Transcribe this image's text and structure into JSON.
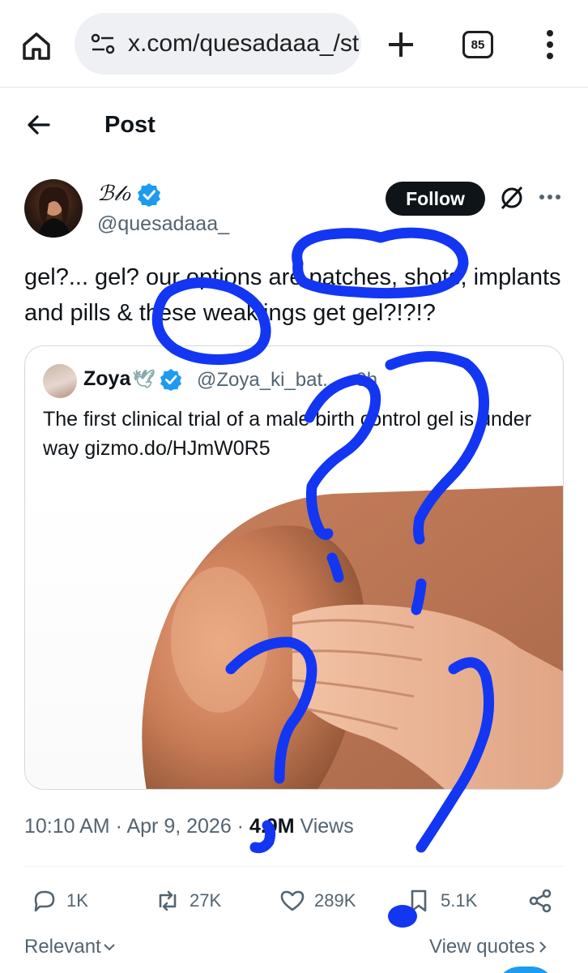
{
  "browser": {
    "url": "x.com/quesadaaa_/st",
    "tab_count": "85",
    "icons": [
      "home-icon",
      "site-settings-icon",
      "plus-icon",
      "tab-switcher-icon",
      "kebab-menu-icon"
    ]
  },
  "header": {
    "title": "Post",
    "back_icon": "arrow-left-icon"
  },
  "post": {
    "author_name": "ℬ𝓁ℴ",
    "author_handle": "@quesadaaa_",
    "verified": true,
    "follow_label": "Follow",
    "text": "gel?... gel? our options are patches, shots, implants and pills & these weaklings get gel?!?!?",
    "timestamp": "10:10 AM · Apr 9, 2026 · ",
    "views_count": "4.9M",
    "views_label": " Views"
  },
  "quoted": {
    "author_name": "Zoya",
    "author_emoji": "🕊",
    "verified": true,
    "handle_time": "@Zoya_ki_bat... · 9h",
    "text": "The first clinical trial of a male birth control gel is under way gizmo.do/HJmW0R5"
  },
  "actions": {
    "replies": "1K",
    "reposts": "27K",
    "likes": "289K",
    "bookmarks": "5.1K"
  },
  "footer": {
    "sort_label": "Relevant",
    "view_quotes_label": "View quotes"
  },
  "colors": {
    "scribble": "#1336f2",
    "verified_blue": "#1d9bf0",
    "muted": "#536471"
  }
}
